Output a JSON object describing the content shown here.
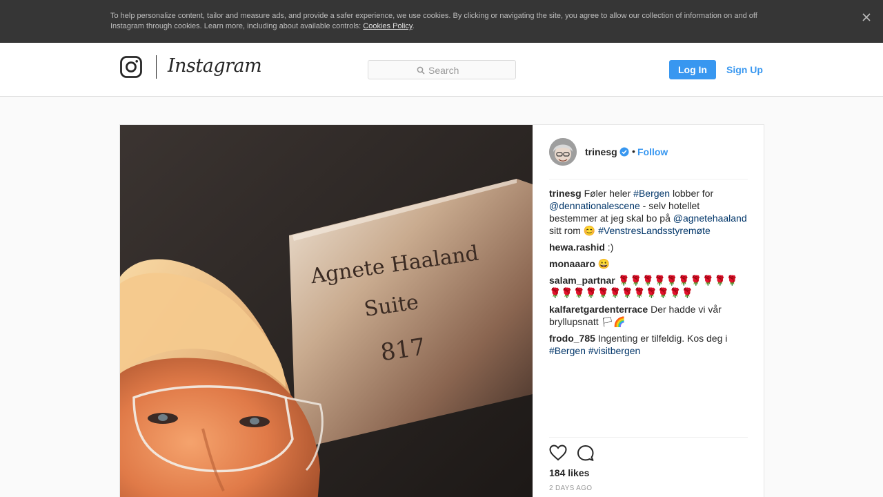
{
  "cookie_banner": {
    "text": "To help personalize content, tailor and measure ads, and provide a safer experience, we use cookies. By clicking or navigating the site, you agree to allow our collection of information on and off Instagram through cookies. Learn more, including about available controls: ",
    "link": "Cookies Policy",
    "suffix": ".",
    "close_icon": "close-icon"
  },
  "header": {
    "brand": "Instagram",
    "search_placeholder": "Search",
    "login_label": "Log In",
    "signup_label": "Sign Up",
    "accent": "#3897f0"
  },
  "post": {
    "photo_sign": {
      "line1": "Agnete Haaland",
      "line2": "Suite",
      "line3": "817"
    },
    "author": "trinesg",
    "verified": true,
    "dot": "•",
    "follow_label": "Follow",
    "caption": {
      "user": "trinesg",
      "t1": " Føler heler ",
      "tag1": "#Bergen",
      "t2": " lobber for ",
      "mention1": "@dennationalescene",
      "t3": " - selv hotellet bestemmer at jeg skal bo på ",
      "mention2": "@agnetehaaland",
      "t4": " sitt rom 😊 ",
      "tag2": "#VenstresLandsstyremøte"
    },
    "comments": [
      {
        "user": "hewa.rashid",
        "text": " :)"
      },
      {
        "user": "monaaaro",
        "text": " 😀"
      },
      {
        "user": "salam_partnar",
        "text": " 🌹🌹🌹🌹🌹🌹🌹🌹🌹🌹🌹🌹🌹🌹🌹🌹🌹🌹🌹🌹🌹🌹"
      },
      {
        "user": "kalfaretgardenterrace",
        "text": " Der hadde vi vår bryllupsnatt 🏳🌈"
      },
      {
        "user": "frodo_785",
        "text": " Ingenting er tilfeldig. Kos deg i ",
        "tag1": "#Bergen",
        "sp": " ",
        "tag2": "#visitbergen"
      }
    ],
    "likes": "184 likes",
    "time": "2 DAYS AGO"
  }
}
